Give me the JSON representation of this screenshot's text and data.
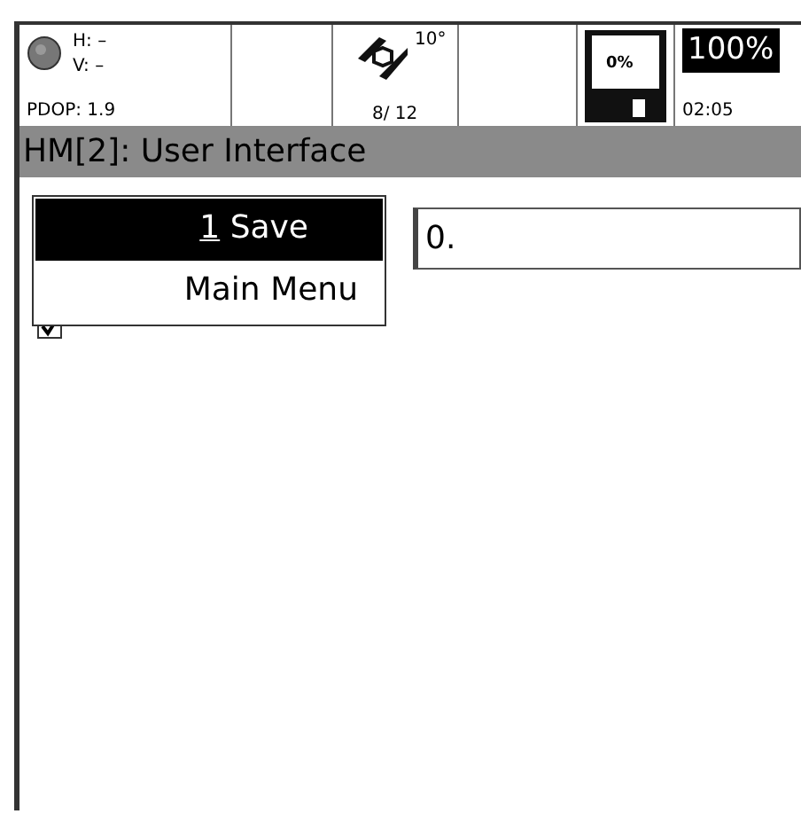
{
  "status_bar": {
    "position": {
      "h": "H: –",
      "v": "V: –",
      "pdop": "PDOP: 1.9"
    },
    "satellites": {
      "mask": "10°",
      "count": "8/ 12"
    },
    "storage": {
      "used": "0%"
    },
    "battery": {
      "level_text": "100%",
      "time": "02:05"
    }
  },
  "window": {
    "title": "HM[2]: User Interface"
  },
  "popup_menu": {
    "items": [
      {
        "hotkey": "1",
        "label": "Save",
        "selected": true
      },
      {
        "label": "Main Menu",
        "selected": false
      }
    ]
  },
  "field": {
    "value": "0."
  },
  "option": {
    "checked": true
  }
}
